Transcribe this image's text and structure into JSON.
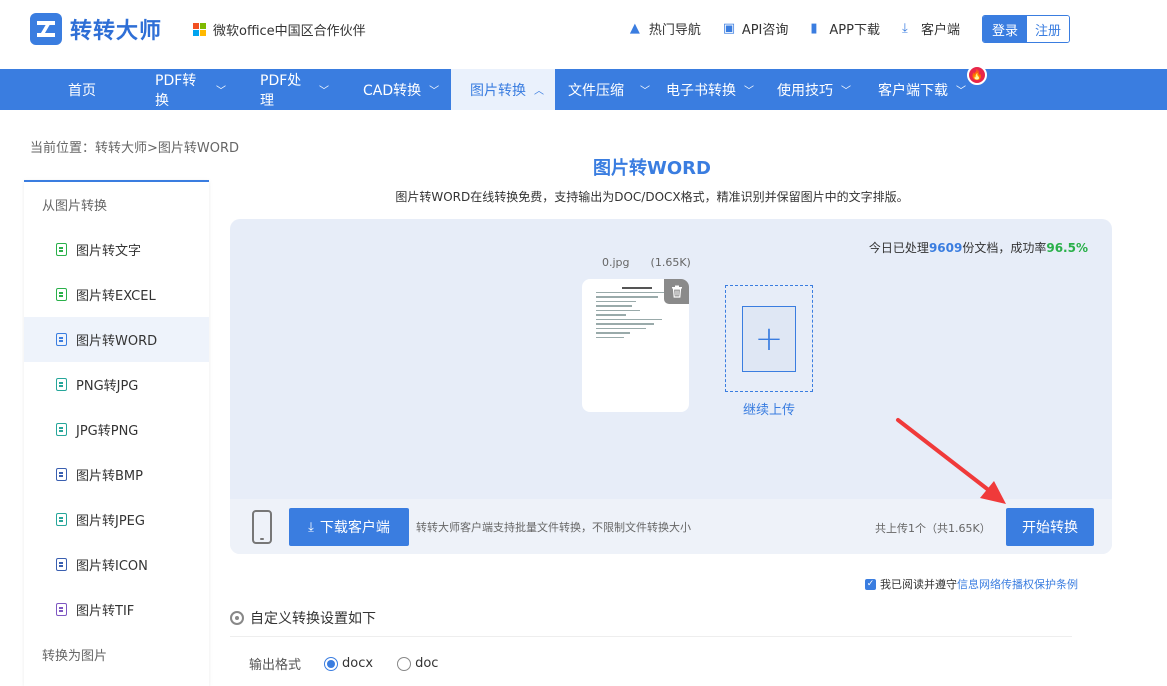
{
  "header": {
    "logo_text": "转转大师",
    "partner_text": "微软office中国区合作伙伴",
    "links": [
      {
        "label": "热门导航",
        "icon": "flame-icon"
      },
      {
        "label": "API咨询",
        "icon": "chat-icon"
      },
      {
        "label": "APP下载",
        "icon": "phone-icon"
      },
      {
        "label": "客户端",
        "icon": "download-icon"
      }
    ],
    "login_label": "登录",
    "register_label": "注册"
  },
  "nav": {
    "items": [
      {
        "label": "首页",
        "chevron": ""
      },
      {
        "label": "PDF转换",
        "chevron": "﹀"
      },
      {
        "label": "PDF处理",
        "chevron": "﹀"
      },
      {
        "label": "CAD转换",
        "chevron": "﹀"
      },
      {
        "label": "图片转换",
        "chevron": "︿"
      },
      {
        "label": "文件压缩",
        "chevron": "﹀"
      },
      {
        "label": "电子书转换",
        "chevron": "﹀"
      },
      {
        "label": "使用技巧",
        "chevron": "﹀"
      },
      {
        "label": "客户端下载",
        "chevron": "﹀"
      }
    ],
    "hot_badge": "🔥"
  },
  "breadcrumb": "当前位置：转转大师>图片转WORD",
  "sidebar": {
    "group1": "从图片转换",
    "items": [
      {
        "label": "图片转文字"
      },
      {
        "label": "图片转EXCEL"
      },
      {
        "label": "图片转WORD"
      },
      {
        "label": "PNG转JPG"
      },
      {
        "label": "JPG转PNG"
      },
      {
        "label": "图片转BMP"
      },
      {
        "label": "图片转JPEG"
      },
      {
        "label": "图片转ICON"
      },
      {
        "label": "图片转TIF"
      }
    ],
    "group2": "转换为图片"
  },
  "main": {
    "title": "图片转WORD",
    "description": "图片转WORD在线转换免费，支持输出为DOC/DOCX格式，精准识别并保留图片中的文字排版。",
    "stats_prefix": "今日已处理",
    "stats_count": "9609",
    "stats_mid": "份文档，成功率",
    "stats_rate": "96.5%",
    "file_name": "0.jpg",
    "file_size": "(1.65K)",
    "continue_upload": "继续上传",
    "add_symbol": "+",
    "download_client": "下载客户端",
    "download_tip": "转转大师客户端支持批量文件转换，不限制文件转换大小",
    "upload_count": "共上传1个（共1.65K）",
    "start_button": "开始转换",
    "agree_prefix": "我已阅读并遵守",
    "agree_link": "信息网络传播权保护条例",
    "settings_title": "自定义转换设置如下",
    "format_label": "输出格式",
    "format_options": [
      "docx",
      "doc"
    ],
    "format_selected": "docx"
  },
  "colors": {
    "accent": "#3a7de0",
    "success": "#2ab04a",
    "hot": "#e8264a",
    "arrow": "#f03a3a"
  }
}
